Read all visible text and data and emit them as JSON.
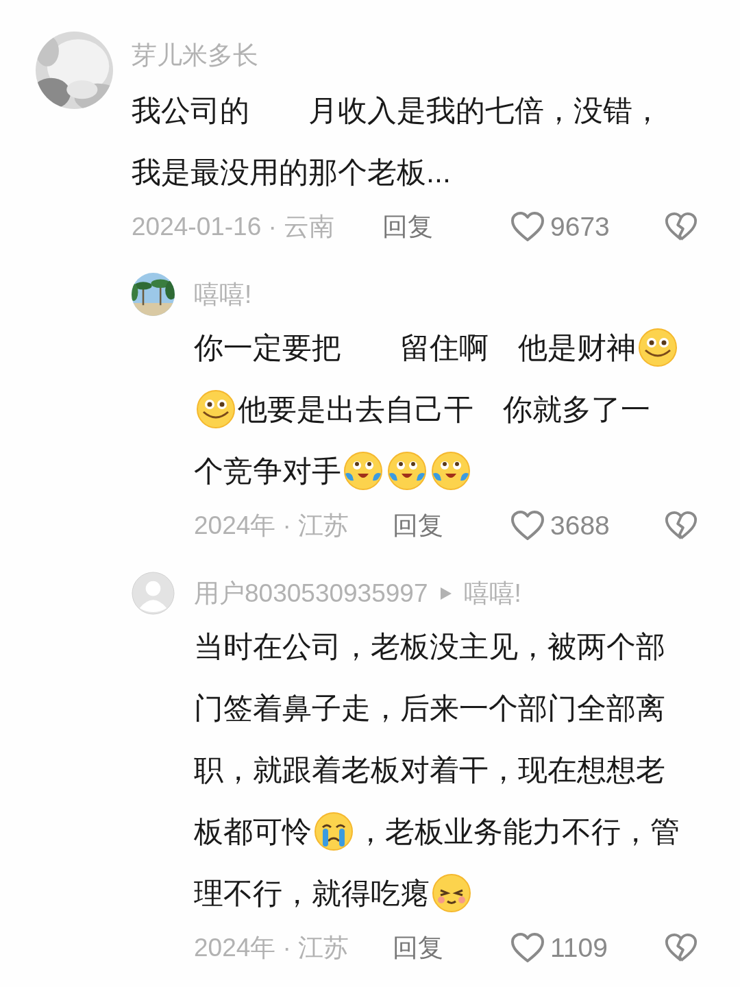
{
  "comments": [
    {
      "author": "芽儿米多长",
      "lines": [
        [
          {
            "kind": "text",
            "text": "我公司的　　月收入是我的七倍，没错，"
          }
        ],
        [
          {
            "kind": "text",
            "text": "我是最没用的那个老板..."
          }
        ]
      ],
      "date": "2024-01-16 · 云南",
      "reply": "回复",
      "likes": "9673",
      "replies": [
        {
          "author": "嘻嘻!",
          "lines": [
            [
              {
                "kind": "text",
                "text": "你一定要把　　留住啊　他是财神"
              },
              {
                "kind": "grin"
              }
            ],
            [
              {
                "kind": "grin"
              },
              {
                "kind": "text",
                "text": "他要是出去自己干　你就多了一"
              }
            ],
            [
              {
                "kind": "text",
                "text": "个竞争对手"
              },
              {
                "kind": "laugh-cry"
              },
              {
                "kind": "laugh-cry"
              },
              {
                "kind": "laugh-cry"
              }
            ]
          ],
          "date": "2024年 · 江苏",
          "reply": "回复",
          "likes": "3688"
        },
        {
          "author": "用户8030530935997",
          "reply_to": "嘻嘻!",
          "lines": [
            [
              {
                "kind": "text",
                "text": "当时在公司，老板没主见，被两个部"
              }
            ],
            [
              {
                "kind": "text",
                "text": "门签着鼻子走，后来一个部门全部离"
              }
            ],
            [
              {
                "kind": "text",
                "text": "职，就跟着老板对着干，现在想想老"
              }
            ],
            [
              {
                "kind": "text",
                "text": "板都可怜"
              },
              {
                "kind": "cry"
              },
              {
                "kind": "text",
                "text": "，老板业务能力不行，管"
              }
            ],
            [
              {
                "kind": "text",
                "text": "理不行，就得吃瘪"
              },
              {
                "kind": "smug"
              }
            ]
          ],
          "date": "2024年 · 江苏",
          "reply": "回复",
          "likes": "1109"
        }
      ]
    }
  ]
}
